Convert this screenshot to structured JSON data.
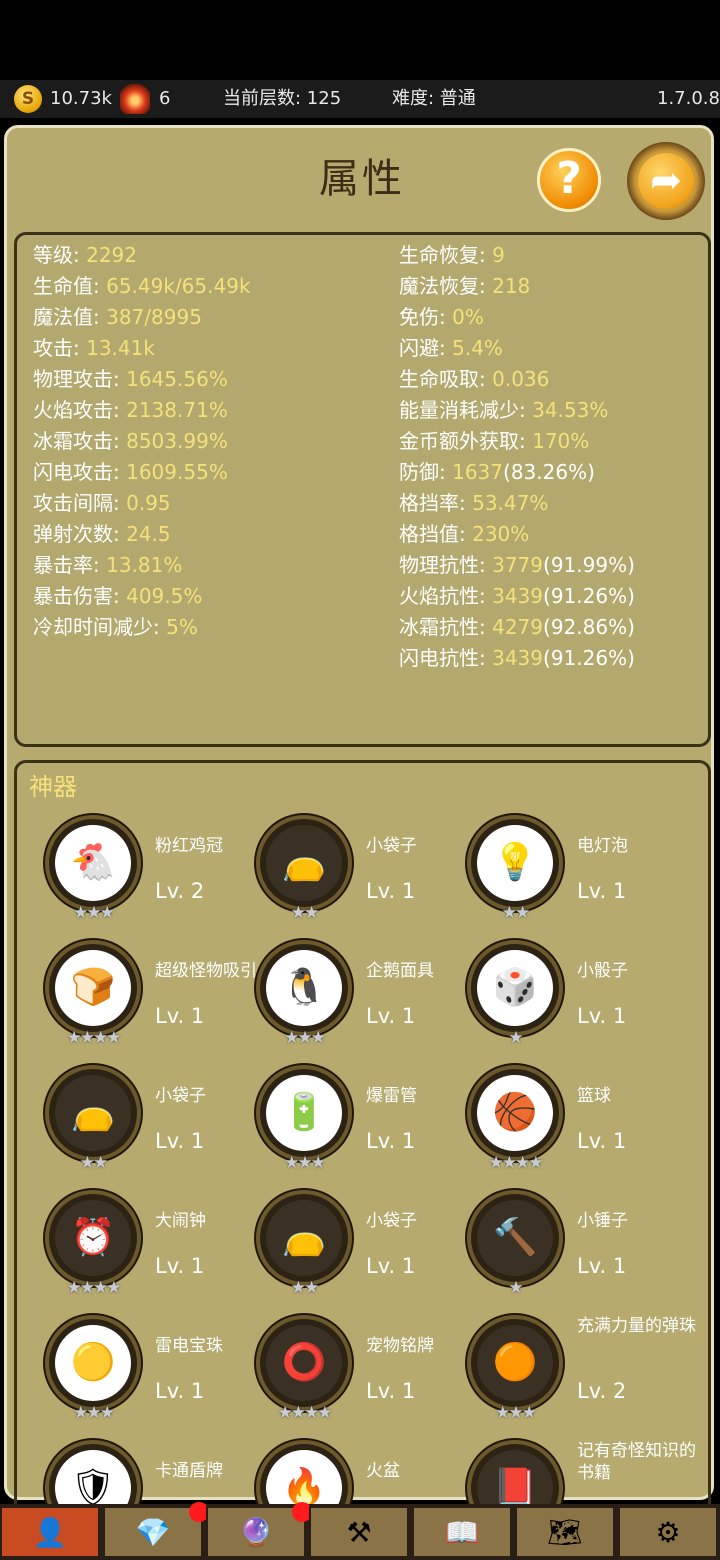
{
  "topbar": {
    "coins": "10.73k",
    "gems": "6",
    "floor_label": "当前层数: 125",
    "difficulty_label": "难度: 普通",
    "version": "1.7.0.8"
  },
  "panel": {
    "title": "属性",
    "help_glyph": "?",
    "next_glyph": "➦"
  },
  "stats_left": [
    {
      "k": "等级: ",
      "v": "2292",
      "s": ""
    },
    {
      "k": "生命值: ",
      "v": "65.49k/65.49k",
      "s": ""
    },
    {
      "k": "魔法值: ",
      "v": "387/8995",
      "s": ""
    },
    {
      "k": "攻击: ",
      "v": "13.41k",
      "s": ""
    },
    {
      "k": "物理攻击: ",
      "v": "1645.56%",
      "s": ""
    },
    {
      "k": "火焰攻击: ",
      "v": "2138.71%",
      "s": ""
    },
    {
      "k": "冰霜攻击: ",
      "v": "8503.99%",
      "s": ""
    },
    {
      "k": "闪电攻击: ",
      "v": "1609.55%",
      "s": ""
    },
    {
      "k": "攻击间隔: ",
      "v": "0.95",
      "s": ""
    },
    {
      "k": "弹射次数: ",
      "v": "24.5",
      "s": ""
    },
    {
      "k": "暴击率: ",
      "v": "13.81%",
      "s": ""
    },
    {
      "k": "暴击伤害: ",
      "v": "409.5%",
      "s": ""
    },
    {
      "k": "冷却时间减少: ",
      "v": "5%",
      "s": ""
    }
  ],
  "stats_right": [
    {
      "k": "生命恢复: ",
      "v": "9",
      "s": ""
    },
    {
      "k": "魔法恢复: ",
      "v": "218",
      "s": ""
    },
    {
      "k": "免伤: ",
      "v": "0%",
      "s": ""
    },
    {
      "k": "闪避: ",
      "v": "5.4%",
      "s": ""
    },
    {
      "k": "生命吸取: ",
      "v": "0.036",
      "s": ""
    },
    {
      "k": "能量消耗减少: ",
      "v": "34.53%",
      "s": ""
    },
    {
      "k": "金币额外获取: ",
      "v": "170%",
      "s": ""
    },
    {
      "k": "防御: ",
      "v": "1637",
      "s": "(83.26%)"
    },
    {
      "k": "格挡率: ",
      "v": "53.47%",
      "s": ""
    },
    {
      "k": "格挡值: ",
      "v": "230%",
      "s": ""
    },
    {
      "k": "物理抗性: ",
      "v": "3779",
      "s": "(91.99%)"
    },
    {
      "k": "火焰抗性: ",
      "v": "3439",
      "s": "(91.26%)"
    },
    {
      "k": "冰霜抗性: ",
      "v": "4279",
      "s": "(92.86%)"
    },
    {
      "k": "闪电抗性: ",
      "v": "3439",
      "s": "(91.26%)"
    }
  ],
  "artifacts_title": "神器",
  "artifacts": [
    {
      "name": "粉红鸡冠",
      "level": "Lv. 2",
      "stars": "★★★",
      "icon": "chicken-icon",
      "glyph": "🐔",
      "dark": false
    },
    {
      "name": "小袋子",
      "level": "Lv. 1",
      "stars": "★★",
      "icon": "pouch-icon",
      "glyph": "👝",
      "dark": true
    },
    {
      "name": "电灯泡",
      "level": "Lv. 1",
      "stars": "★★",
      "icon": "lightbulb-icon",
      "glyph": "💡",
      "dark": false
    },
    {
      "name": "超级怪物吸引",
      "level": "Lv. 1",
      "stars": "★★★★",
      "icon": "toast-icon",
      "glyph": "🍞",
      "dark": false
    },
    {
      "name": "企鹅面具",
      "level": "Lv. 1",
      "stars": "★★★",
      "icon": "penguin-icon",
      "glyph": "🐧",
      "dark": false
    },
    {
      "name": "小骰子",
      "level": "Lv. 1",
      "stars": "★",
      "icon": "dice-icon",
      "glyph": "🎲",
      "dark": false
    },
    {
      "name": "小袋子",
      "level": "Lv. 1",
      "stars": "★★",
      "icon": "pouch-icon",
      "glyph": "👝",
      "dark": true
    },
    {
      "name": "爆雷管",
      "level": "Lv. 1",
      "stars": "★★★",
      "icon": "battery-icon",
      "glyph": "🔋",
      "dark": false
    },
    {
      "name": "篮球",
      "level": "Lv. 1",
      "stars": "★★★★",
      "icon": "basketball-icon",
      "glyph": "🏀",
      "dark": false
    },
    {
      "name": "大闹钟",
      "level": "Lv. 1",
      "stars": "★★★★",
      "icon": "alarm-clock-icon",
      "glyph": "⏰",
      "dark": true
    },
    {
      "name": "小袋子",
      "level": "Lv. 1",
      "stars": "★★",
      "icon": "pouch-icon",
      "glyph": "👝",
      "dark": true
    },
    {
      "name": "小锤子",
      "level": "Lv. 1",
      "stars": "★",
      "icon": "hammer-icon",
      "glyph": "🔨",
      "dark": true
    },
    {
      "name": "雷电宝珠",
      "level": "Lv. 1",
      "stars": "★★★",
      "icon": "thunder-orb-icon",
      "glyph": "🟡",
      "dark": false
    },
    {
      "name": "宠物铭牌",
      "level": "Lv. 1",
      "stars": "★★★★",
      "icon": "pet-collar-icon",
      "glyph": "⭕",
      "dark": true
    },
    {
      "name": "充满力量的弹珠",
      "level": "Lv. 2",
      "stars": "★★★",
      "icon": "power-marble-icon",
      "glyph": "🟠",
      "dark": true
    },
    {
      "name": "卡通盾牌",
      "level": "",
      "stars": "",
      "icon": "shield-icon",
      "glyph": "🛡",
      "dark": false
    },
    {
      "name": "火盆",
      "level": "",
      "stars": "",
      "icon": "brazier-icon",
      "glyph": "🔥",
      "dark": false
    },
    {
      "name": "记有奇怪知识的书籍",
      "level": "",
      "stars": "",
      "icon": "book-icon",
      "glyph": "📕",
      "dark": true
    }
  ],
  "tabs": [
    {
      "icon": "character-icon",
      "glyph": "👤",
      "active": true,
      "badge": false
    },
    {
      "icon": "crystal-icon",
      "glyph": "💎",
      "active": false,
      "badge": true
    },
    {
      "icon": "purple-gem-icon",
      "glyph": "🔮",
      "active": false,
      "badge": true
    },
    {
      "icon": "anvil-icon",
      "glyph": "⚒",
      "active": false,
      "badge": false
    },
    {
      "icon": "spellbook-icon",
      "glyph": "📖",
      "active": false,
      "badge": false
    },
    {
      "icon": "map-icon",
      "glyph": "🗺",
      "active": false,
      "badge": false
    },
    {
      "icon": "settings-gear-icon",
      "glyph": "⚙",
      "active": false,
      "badge": false
    }
  ]
}
